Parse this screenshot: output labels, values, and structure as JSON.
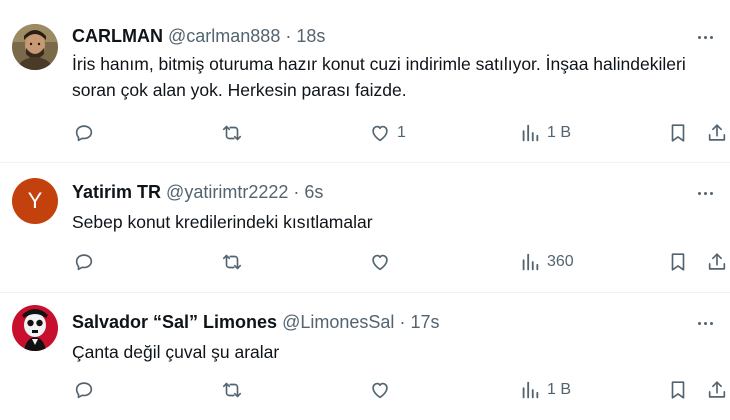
{
  "tweets": [
    {
      "name": "CARLMAN",
      "handle": "@carlman888",
      "separator": "·",
      "time": "18s",
      "text": "İris hanım, bitmiş oturuma hazır konut cuzi indirimle satılıyor. İnşaa halindekileri soran çok alan yok. Herkesin parası faizde.",
      "likes": "1",
      "views": "1 B"
    },
    {
      "name": "Yatirim TR",
      "handle": "@yatirimtr2222",
      "separator": "·",
      "time": "6s",
      "avatar_letter": "Y",
      "text": "Sebep konut kredilerindeki kısıtlamalar",
      "likes": "",
      "views": "360"
    },
    {
      "name": "Salvador “Sal” Limones",
      "handle": "@LimonesSal",
      "separator": "·",
      "time": "17s",
      "text": "Çanta değil çuval şu aralar",
      "likes": "",
      "views": "1 B"
    }
  ],
  "icons": {
    "reply": "reply-icon",
    "retweet": "retweet-icon",
    "like": "heart-icon",
    "views": "views-icon",
    "bookmark": "bookmark-icon",
    "share": "share-icon",
    "more": "more-icon"
  },
  "colors": {
    "text": "#0f1419",
    "secondary": "#536471",
    "divider": "#eff3f4",
    "avatar2": "#c2410c",
    "avatar3": "#c8102e"
  }
}
